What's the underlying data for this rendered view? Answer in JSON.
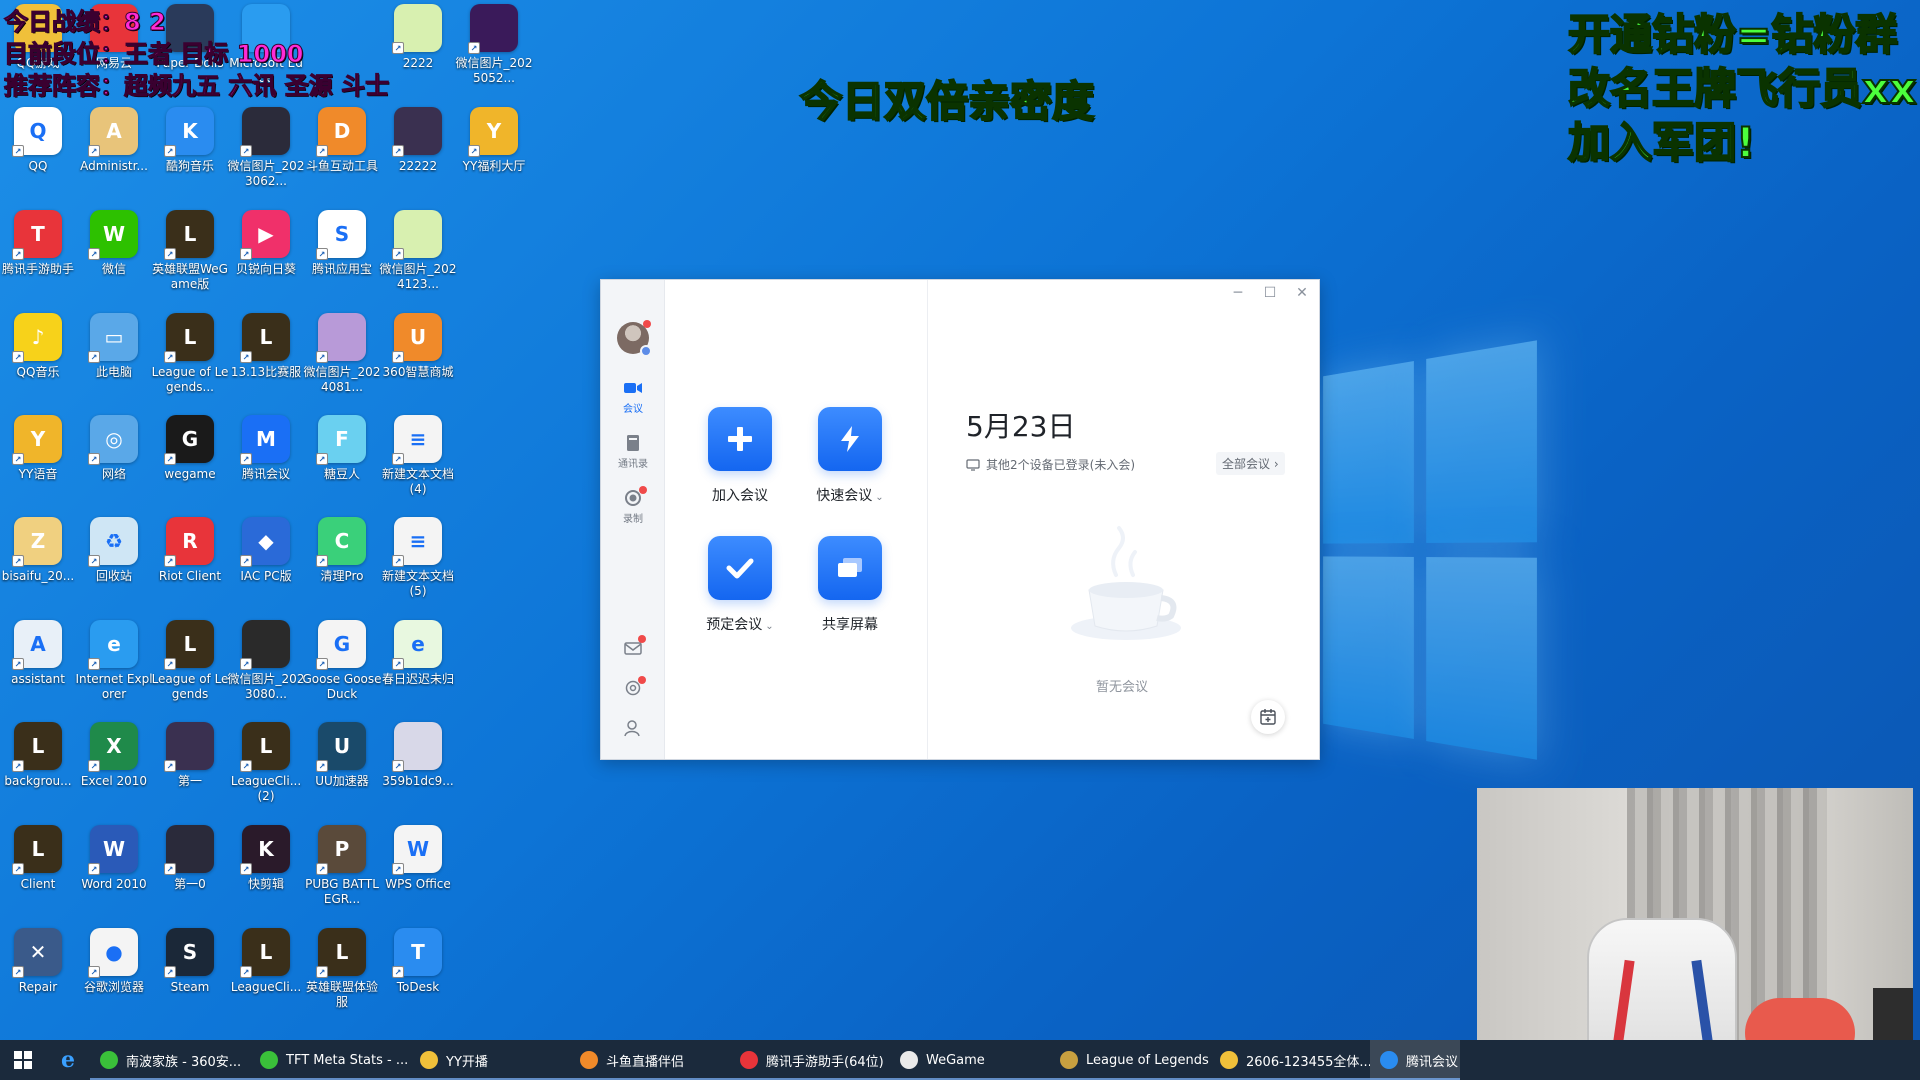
{
  "overlay": {
    "left_lines": [
      "今日战绩：8 2",
      "目前段位：王者 目标 1000",
      "推荐阵容：超频九五 六讯 圣源 斗士"
    ],
    "center": "今日双倍亲密度",
    "right_lines": [
      "开通钻粉=钻粉群",
      "改名王牌飞行员xx",
      "加入军团!"
    ]
  },
  "desktop_icons": [
    {
      "label": "QQ",
      "color": "#ffffff",
      "glyph": "Q"
    },
    {
      "label": "Administr...",
      "color": "#e8c47a",
      "glyph": "A"
    },
    {
      "label": "酷狗音乐",
      "color": "#2a8cf0",
      "glyph": "K"
    },
    {
      "label": "微信图片_2023062...",
      "color": "#2b2b3a",
      "glyph": ""
    },
    {
      "label": "斗鱼互动工具",
      "color": "#f08a2a",
      "glyph": "D"
    },
    {
      "label": "22222",
      "color": "#3a3050",
      "glyph": ""
    },
    {
      "label": "YY福利大厅",
      "color": "#f0b52a",
      "glyph": "Y"
    },
    {
      "label": "2222",
      "color": "#d8f0b0",
      "glyph": ""
    },
    {
      "label": "微信图片_2025052...",
      "color": "#3a1a5a",
      "glyph": ""
    },
    {
      "label": "腾讯手游助手",
      "color": "#e8343a",
      "glyph": "T"
    },
    {
      "label": "微信",
      "color": "#2dc100",
      "glyph": "W"
    },
    {
      "label": "英雄联盟WeGame版",
      "color": "#3a2f1a",
      "glyph": "L"
    },
    {
      "label": "贝锐向日葵",
      "color": "#f0306a",
      "glyph": "▶"
    },
    {
      "label": "腾讯应用宝",
      "color": "#ffffff",
      "glyph": "S"
    },
    {
      "label": "微信图片_2024123...",
      "color": "#d8f0b0",
      "glyph": ""
    },
    {
      "label": "QQ音乐",
      "color": "#f7d21a",
      "glyph": "♪"
    },
    {
      "label": "此电脑",
      "color": "#5aa8e8",
      "glyph": "▭"
    },
    {
      "label": "League of Legends...",
      "color": "#3a2f1a",
      "glyph": "L"
    },
    {
      "label": "13.13比赛服",
      "color": "#3a2f1a",
      "glyph": "L"
    },
    {
      "label": "微信图片_2024081...",
      "color": "#b89ad8",
      "glyph": ""
    },
    {
      "label": "360智慧商城",
      "color": "#f08a2a",
      "glyph": "U"
    },
    {
      "label": "YY语音",
      "color": "#f0b52a",
      "glyph": "Y"
    },
    {
      "label": "网络",
      "color": "#5aa8e8",
      "glyph": "◎"
    },
    {
      "label": "wegame",
      "color": "#1a1a1a",
      "glyph": "G"
    },
    {
      "label": "腾讯会议",
      "color": "#1a6ff5",
      "glyph": "M"
    },
    {
      "label": "糖豆人",
      "color": "#6ad0f0",
      "glyph": "F"
    },
    {
      "label": "新建文本文档(4)",
      "color": "#f4f4f4",
      "glyph": "≡"
    },
    {
      "label": "bisaifu_20...",
      "color": "#f0d080",
      "glyph": "Z"
    },
    {
      "label": "回收站",
      "color": "#cfe6f5",
      "glyph": "♻"
    },
    {
      "label": "Riot Client",
      "color": "#e8343a",
      "glyph": "R"
    },
    {
      "label": "IAC PC版",
      "color": "#2a6ad8",
      "glyph": "◆"
    },
    {
      "label": "清理Pro",
      "color": "#3ad07a",
      "glyph": "C"
    },
    {
      "label": "新建文本文档(5)",
      "color": "#f4f4f4",
      "glyph": "≡"
    },
    {
      "label": "assistant",
      "color": "#e8f0f8",
      "glyph": "A"
    },
    {
      "label": "Internet Explorer",
      "color": "#2a9cf0",
      "glyph": "e"
    },
    {
      "label": "League of Legends",
      "color": "#3a2f1a",
      "glyph": "L"
    },
    {
      "label": "微信图片_2023080...",
      "color": "#2a2a2a",
      "glyph": ""
    },
    {
      "label": "Goose Goose Duck",
      "color": "#f4f4f4",
      "glyph": "G"
    },
    {
      "label": "春日迟迟未归",
      "color": "#e8f8e0",
      "glyph": "e"
    },
    {
      "label": "backgrou...",
      "color": "#3a2f1a",
      "glyph": "L"
    },
    {
      "label": "Excel 2010",
      "color": "#1f8a4a",
      "glyph": "X"
    },
    {
      "label": "第一",
      "color": "#3a3050",
      "glyph": ""
    },
    {
      "label": "LeagueCli... (2)",
      "color": "#3a2f1a",
      "glyph": "L"
    },
    {
      "label": "UU加速器",
      "color": "#1a4a6a",
      "glyph": "U"
    },
    {
      "label": "359b1dc9...",
      "color": "#d8d8e8",
      "glyph": ""
    },
    {
      "label": "Client",
      "color": "#3a2f1a",
      "glyph": "L"
    },
    {
      "label": "Word 2010",
      "color": "#2a5ab8",
      "glyph": "W"
    },
    {
      "label": "第一0",
      "color": "#2a2a3a",
      "glyph": ""
    },
    {
      "label": "快剪辑",
      "color": "#2a1a2a",
      "glyph": "K"
    },
    {
      "label": "PUBG BATTLEGR...",
      "color": "#5a4a3a",
      "glyph": "P"
    },
    {
      "label": "WPS Office",
      "color": "#f4f4f4",
      "glyph": "W"
    },
    {
      "label": "Repair",
      "color": "#3a5a8a",
      "glyph": "✕"
    },
    {
      "label": "谷歌浏览器",
      "color": "#f4f4f4",
      "glyph": "●"
    },
    {
      "label": "Steam",
      "color": "#1b2838",
      "glyph": "S"
    },
    {
      "label": "LeagueCli...",
      "color": "#3a2f1a",
      "glyph": "L"
    },
    {
      "label": "英雄联盟体验服",
      "color": "#3a2f1a",
      "glyph": "L"
    },
    {
      "label": "ToDesk",
      "color": "#2a8cf0",
      "glyph": "T"
    }
  ],
  "top_row_icons": [
    {
      "label": "QQ游戏",
      "color": "#f0c03a"
    },
    {
      "label": "网易云",
      "color": "#e8343a"
    },
    {
      "label": "Paper Dolls",
      "color": "#2a3a5a"
    },
    {
      "label": "Microsoft Edge",
      "color": "#2a9cf0"
    }
  ],
  "meeting": {
    "sidebar": {
      "meetings": "会议",
      "contacts": "通讯录",
      "record": "录制"
    },
    "actions": [
      {
        "label": "加入会议",
        "caret": ""
      },
      {
        "label": "快速会议",
        "caret": "⌄"
      },
      {
        "label": "预定会议",
        "caret": "⌄"
      },
      {
        "label": "共享屏幕",
        "caret": ""
      }
    ],
    "date": "5月23日",
    "devices_text": "其他2个设备已登录(未入会)",
    "all_meetings": "全部会议 ›",
    "empty_text": "暂无会议"
  },
  "taskbar": {
    "items": [
      {
        "label": "南波家族 - 360安...",
        "color": "#3ac03a"
      },
      {
        "label": "TFT Meta Stats - ...",
        "color": "#3ac03a"
      },
      {
        "label": "YY开播",
        "color": "#f0c03a"
      },
      {
        "label": "斗鱼直播伴侣",
        "color": "#f08a2a"
      },
      {
        "label": "腾讯手游助手(64位)",
        "color": "#e8343a"
      },
      {
        "label": "WeGame",
        "color": "#eaeaea"
      },
      {
        "label": "League of Legends",
        "color": "#c8a040"
      },
      {
        "label": "2606-123455全体...",
        "color": "#f0c03a"
      },
      {
        "label": "腾讯会议",
        "color": "#2a8cf0"
      }
    ]
  }
}
